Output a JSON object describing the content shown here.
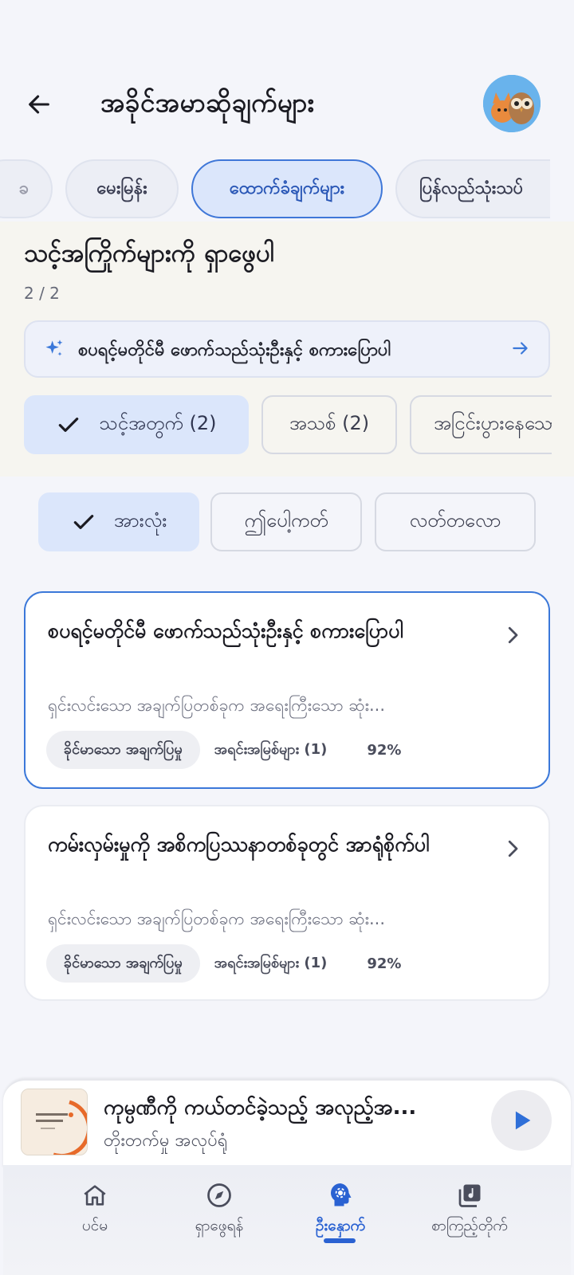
{
  "header": {
    "title": "အခိုင်အမာဆိုချက်များ"
  },
  "tabs": [
    {
      "label": "ခ"
    },
    {
      "label": "မေးမြန်း"
    },
    {
      "label": "ထောက်ခံချက်များ"
    },
    {
      "label": "ပြန်လည်သုံးသပ်"
    }
  ],
  "section": {
    "title": "သင့်အကြိုက်များကို ရှာဖွေပါ",
    "count": "2 / 2",
    "ask_label": "စပရင့်မတိုင်မီ ဖောက်သည်သုံးဦးနှင့် စကားပြောပါ"
  },
  "filters_primary": [
    {
      "label": "သင့်အတွက် (2)",
      "selected": true
    },
    {
      "label": "အသစ် (2)",
      "selected": false
    },
    {
      "label": "အငြင်းပွားနေသော",
      "selected": false
    }
  ],
  "filters_secondary": [
    {
      "label": "အားလုံး",
      "selected": true
    },
    {
      "label": "ဤပေါ့ကတ်",
      "selected": false
    },
    {
      "label": "လတ်တလော",
      "selected": false
    }
  ],
  "cards": [
    {
      "title": "စပရင့်မတိုင်မီ ဖောက်သည်သုံးဦးနှင့် စကားပြောပါ",
      "description": "ရှင်းလင်းသော အချက်ပြတစ်ခုက အရေးကြီးသော ဆုံး...",
      "tag": "ခိုင်မာသော အချက်ပြမှု",
      "sources": "အရင်းအမြစ်များ (1)",
      "score": "92%"
    },
    {
      "title": "ကမ်းလှမ်းမှုကို အစိကပြဿနာတစ်ခုတွင် အာရုံစိုက်ပါ",
      "description": "ရှင်းလင်းသော အချက်ပြတစ်ခုက အရေးကြီးသော ဆုံး...",
      "tag": "ခိုင်မာသော အချက်ပြမှု",
      "sources": "အရင်းအမြစ်များ (1)",
      "score": "92%"
    }
  ],
  "player": {
    "title": "ကုမ္ပဏီကို ကယ်တင်ခဲ့သည့် အလုည့်အ...",
    "subtitle": "တိုးတက်မှု အလုပ်ရုံ"
  },
  "bottom_nav": [
    {
      "label": "ပင်မ",
      "icon": "home-icon"
    },
    {
      "label": "ရှာဖွေရန်",
      "icon": "compass-icon"
    },
    {
      "label": "ဦးနှောက်",
      "icon": "brain-gear-icon",
      "active": true
    },
    {
      "label": "စာကြည့်တိုက်",
      "icon": "library-music-icon"
    }
  ],
  "colors": {
    "accent": "#3b78d9",
    "chip_selected": "#dbe6fb",
    "section_bg": "#f6f5f0",
    "page_bg": "#f4f5fa"
  }
}
